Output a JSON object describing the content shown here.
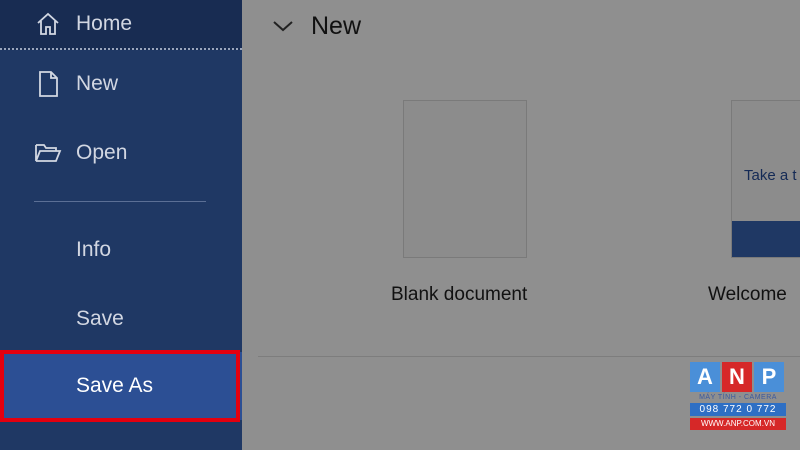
{
  "sidebar": {
    "items": [
      {
        "label": "Home",
        "icon": "home-icon"
      },
      {
        "label": "New",
        "icon": "document-icon"
      },
      {
        "label": "Open",
        "icon": "folder-open-icon"
      },
      {
        "label": "Info"
      },
      {
        "label": "Save"
      },
      {
        "label": "Save As"
      }
    ]
  },
  "main": {
    "section_title": "New",
    "templates": [
      {
        "label": "Blank document"
      },
      {
        "label": "Welcome",
        "thumb_text": "Take a t"
      }
    ]
  },
  "watermark": {
    "letters": [
      "A",
      "N",
      "P"
    ],
    "tile_colors": [
      "#4a8fd8",
      "#d62828",
      "#4a8fd8"
    ],
    "subtitle": "MÁY TÍNH - CAMERA",
    "phone": "098 772 0 772",
    "website": "WWW.ANP.COM.VN"
  },
  "colors": {
    "sidebar_bg": "#1f3864",
    "selected_bg": "#2c4f94",
    "highlight_red": "#e3000f"
  }
}
